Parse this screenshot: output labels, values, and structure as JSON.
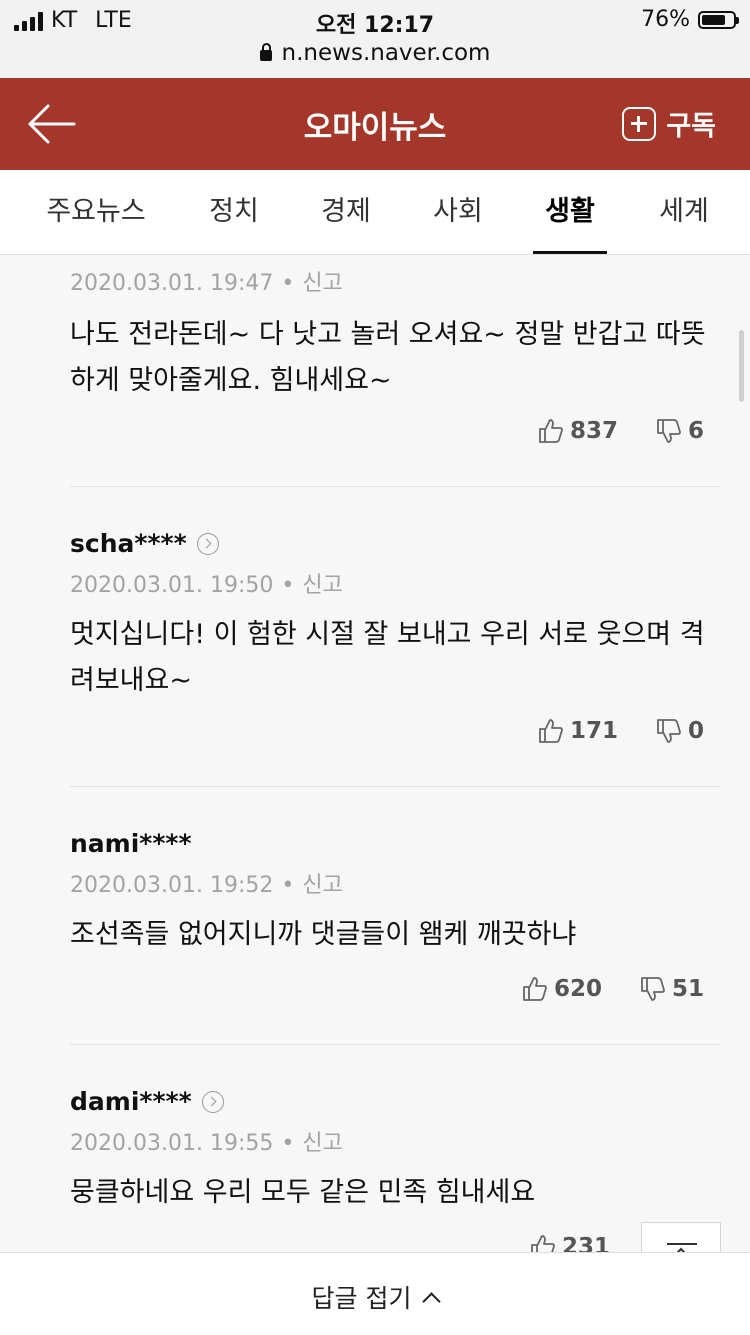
{
  "status": {
    "carrier": "KT",
    "network": "LTE",
    "time": "오전 12:17",
    "battery": "76%",
    "battery_level": 0.76,
    "url": "n.news.naver.com"
  },
  "header": {
    "title": "오마이뉴스",
    "subscribe_label": "구독"
  },
  "tabs": [
    "주요뉴스",
    "정치",
    "경제",
    "사회",
    "생활",
    "세계"
  ],
  "active_tab": "생활",
  "comments": [
    {
      "nick": "",
      "date": "2020.03.01. 19:47",
      "report": "신고",
      "text": "나도 전라돈데~ 다 낫고 놀러 오셔요~ 정말 반갑고 따뜻하게 맞아줄게요. 힘내세요~",
      "likes": "837",
      "dislikes": "6"
    },
    {
      "nick": "scha****",
      "date": "2020.03.01. 19:50",
      "report": "신고",
      "text": "멋지십니다! 이 험한 시절 잘 보내고 우리 서로 웃으며 격려보내요~",
      "likes": "171",
      "dislikes": "0"
    },
    {
      "nick": "nami****",
      "date": "2020.03.01. 19:52",
      "report": "신고",
      "text": "조선족들 없어지니까 댓글들이 왬케 깨끗하냐",
      "likes": "620",
      "dislikes": "51"
    },
    {
      "nick": "dami****",
      "date": "2020.03.01. 19:55",
      "report": "신고",
      "text": "뭉클하네요 우리 모두 같은 민족 힘내세요",
      "likes": "231",
      "dislikes": ""
    }
  ],
  "footer": {
    "fold_label": "답글 접기"
  }
}
